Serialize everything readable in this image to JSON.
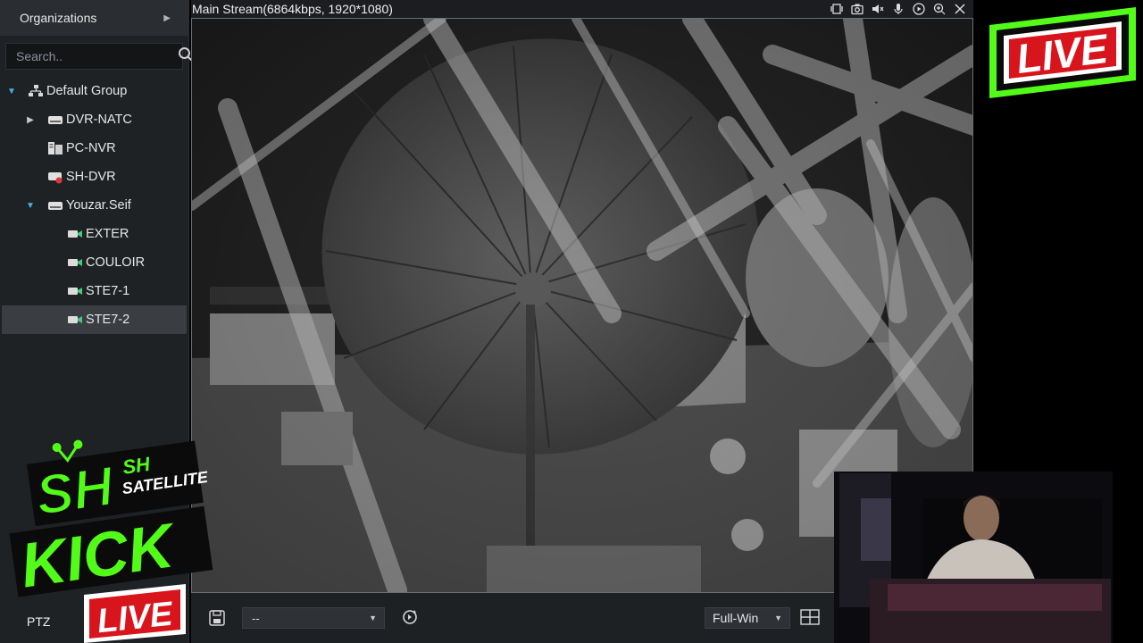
{
  "sidebar": {
    "header": "Organizations",
    "search_placeholder": "Search..",
    "tree": [
      {
        "label": "Default Group",
        "level": 0,
        "expanded": true,
        "icon": "group-icon"
      },
      {
        "label": "DVR-NATC",
        "level": 1,
        "expanded": false,
        "icon": "dvr-icon"
      },
      {
        "label": "PC-NVR",
        "level": 1,
        "icon": "nvr-icon"
      },
      {
        "label": "SH-DVR",
        "level": 1,
        "icon": "dvr-offline-icon"
      },
      {
        "label": "Youzar.Seif",
        "level": 1,
        "expanded": true,
        "icon": "dvr-icon"
      },
      {
        "label": "EXTER",
        "level": 2,
        "icon": "camera-icon"
      },
      {
        "label": "COULOIR",
        "level": 2,
        "icon": "camera-icon"
      },
      {
        "label": "STE7-1",
        "level": 2,
        "icon": "camera-icon"
      },
      {
        "label": "STE7-2",
        "level": 2,
        "icon": "camera-icon",
        "selected": true
      }
    ],
    "ptz_label": "PTZ"
  },
  "video": {
    "title": "Main Stream(6864kbps, 1920*1080)"
  },
  "bottom_bar": {
    "preset_value": "--",
    "layout_value": "Full-Win"
  },
  "overlays": {
    "live_top": "LIVE",
    "live_bottom": "LIVE",
    "brand_initials": "SH",
    "brand_sh": "SH",
    "brand_satellite": "SATELLITE",
    "brand_kick": "KICK"
  },
  "colors": {
    "accent_blue": "#48b0e8",
    "kick_green": "#53fc18",
    "live_red": "#d8141c",
    "panel_bg": "#1f2225"
  }
}
